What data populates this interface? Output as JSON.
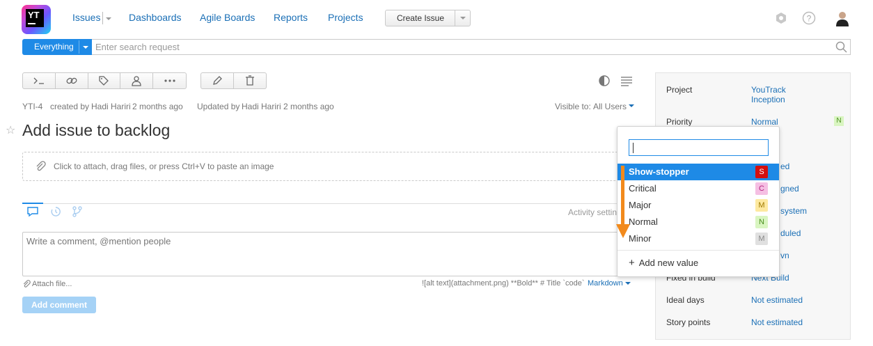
{
  "header": {
    "nav": [
      "Issues",
      "Dashboards",
      "Agile Boards",
      "Reports",
      "Projects"
    ],
    "create_issue": "Create Issue"
  },
  "search": {
    "scope": "Everything",
    "placeholder": "Enter search request"
  },
  "issue": {
    "id": "YTI-4",
    "created_prefix": "created by",
    "created_by": "Hadi Hariri",
    "created_when": "2 months ago",
    "updated_prefix": "Updated by",
    "updated_by": "Hadi Hariri",
    "updated_when": "2 months ago",
    "visible_label": "Visible to:",
    "visible_value": "All Users",
    "title": "Add issue to backlog",
    "attach_hint": "Click to attach, drag files, or press Ctrl+V to paste an image",
    "activity_settings": "Activity settin",
    "comment_placeholder": "Write a comment, @mention people",
    "attach_file": "Attach file...",
    "markdown_hint": "![alt text](attachment.png) **Bold** # Title `code`",
    "markdown_label": "Markdown",
    "add_comment": "Add comment"
  },
  "panel": {
    "fields": [
      {
        "label": "Project",
        "value": "YouTrack Inception"
      },
      {
        "label": "Priority",
        "value": "Normal",
        "badge": "N"
      },
      {
        "label": "",
        "value": "ed"
      },
      {
        "label": "",
        "value": "gned"
      },
      {
        "label": "",
        "value": "system"
      },
      {
        "label": "",
        "value": "duled"
      },
      {
        "label": "",
        "value": "vn"
      },
      {
        "label": "Fixed in build",
        "value": "Next Build"
      },
      {
        "label": "Ideal days",
        "value": "Not estimated"
      },
      {
        "label": "Story points",
        "value": "Not estimated"
      }
    ]
  },
  "dropdown": {
    "items": [
      {
        "label": "Show-stopper",
        "badge": "S",
        "selected": true
      },
      {
        "label": "Critical",
        "badge": "C"
      },
      {
        "label": "Major",
        "badge": "M"
      },
      {
        "label": "Normal",
        "badge": "N"
      },
      {
        "label": "Minor",
        "badge": "M"
      }
    ],
    "add_new": "Add new value"
  },
  "colors": {
    "accent": "#1e8ae6",
    "arrow": "#f28a1c",
    "badge_S": "#d40f0f",
    "badge_C": "#f5bfe3",
    "badge_M": "#fde9a0",
    "badge_N": "#d9f5c1",
    "badge_minor": "#e0e0e0"
  }
}
